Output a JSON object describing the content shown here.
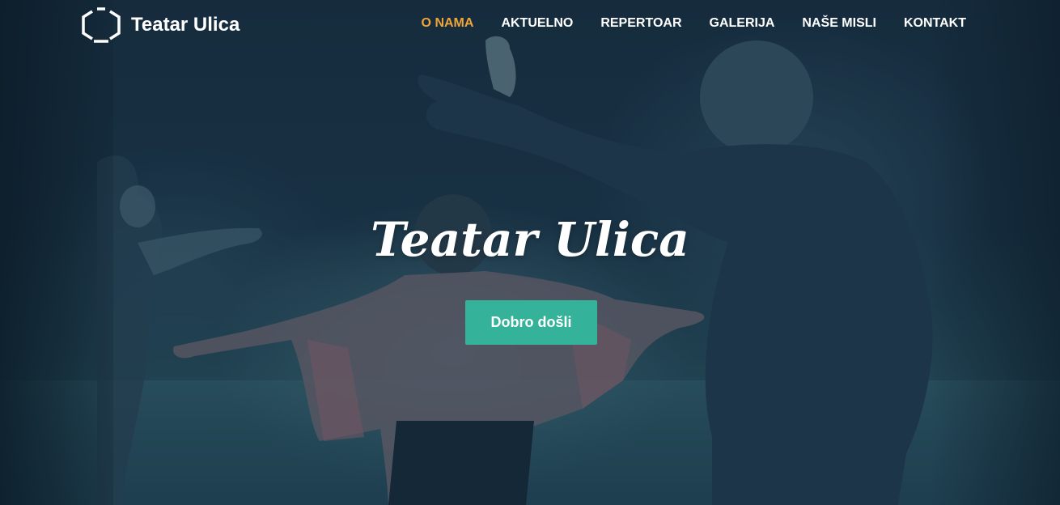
{
  "brand": {
    "name": "Teatar Ulica",
    "icon": "hexagon-logo-icon"
  },
  "nav": {
    "items": [
      {
        "label": "O NAMA",
        "active": true
      },
      {
        "label": "AKTUELNO",
        "active": false
      },
      {
        "label": "REPERTOAR",
        "active": false
      },
      {
        "label": "GALERIJA",
        "active": false
      },
      {
        "label": "NAŠE MISLI",
        "active": false
      },
      {
        "label": "KONTAKT",
        "active": false
      }
    ]
  },
  "hero": {
    "title": "Teatar Ulica",
    "cta_label": "Dobro došli"
  },
  "colors": {
    "accent_active_nav": "#f0a53a",
    "cta_background": "#35b29a",
    "text": "#ffffff",
    "overlay": "#1a3142"
  }
}
